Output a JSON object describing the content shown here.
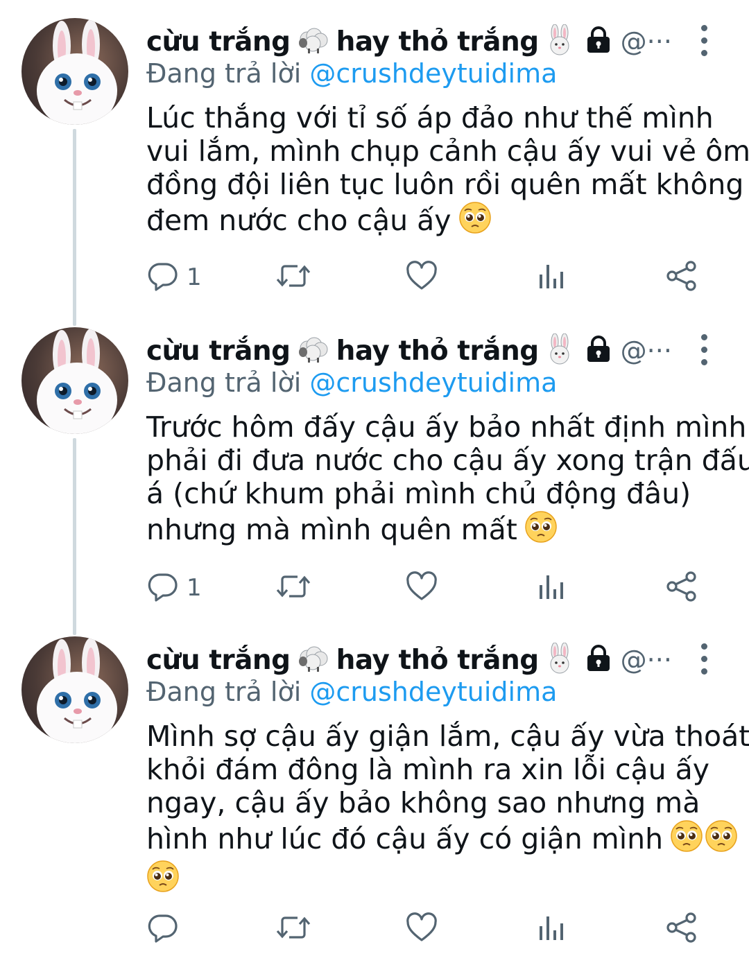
{
  "tweets": [
    {
      "display_name": "cừu trắng",
      "display_name_part2": "hay thỏ trắng",
      "handle": "@···",
      "reply_prefix": "Đang trả lời",
      "reply_to": "@crushdeytuidima",
      "lines": [
        "Lúc thắng với tỉ số áp đảo như thế mình",
        "vui lắm, mình chụp cảnh cậu ấy vui vẻ ôm",
        "đồng đội liên tục luôn rồi quên mất không",
        "đem nước cho cậu ấy"
      ],
      "reply_count": "1"
    },
    {
      "display_name": "cừu trắng",
      "display_name_part2": "hay thỏ trắng",
      "handle": "@···",
      "reply_prefix": "Đang trả lời",
      "reply_to": "@crushdeytuidima",
      "lines": [
        "Trước hôm đấy cậu ấy bảo nhất định mình",
        "phải đi đưa nước cho cậu ấy xong trận đấu",
        "á (chứ khum phải mình chủ động đâu)",
        "nhưng mà mình quên mất"
      ],
      "reply_count": "1"
    },
    {
      "display_name": "cừu trắng",
      "display_name_part2": "hay thỏ trắng",
      "handle": "@···",
      "reply_prefix": "Đang trả lời",
      "reply_to": "@crushdeytuidima",
      "lines": [
        "Mình sợ cậu ấy giận lắm, cậu ấy vừa thoát",
        "khỏi đám đông là mình ra xin lỗi cậu ấy",
        "ngay, cậu ấy bảo không sao nhưng mà",
        "hình như lúc đó cậu ấy có giận mình",
        ""
      ],
      "reply_count": ""
    }
  ],
  "icons": {
    "reply": "reply-icon",
    "retweet": "retweet-icon",
    "like": "heart-icon",
    "views": "analytics-icon",
    "share": "share-icon",
    "protected": "lock-icon",
    "more": "more-icon",
    "emoji_sheep": "sheep-emoji",
    "emoji_rabbit": "rabbit-emoji",
    "emoji_pleading": "pleading-face-emoji"
  },
  "colors": {
    "text": "#0f1419",
    "secondary": "#536471",
    "link": "#1d9bf0",
    "thread_line": "#cfd9de"
  }
}
